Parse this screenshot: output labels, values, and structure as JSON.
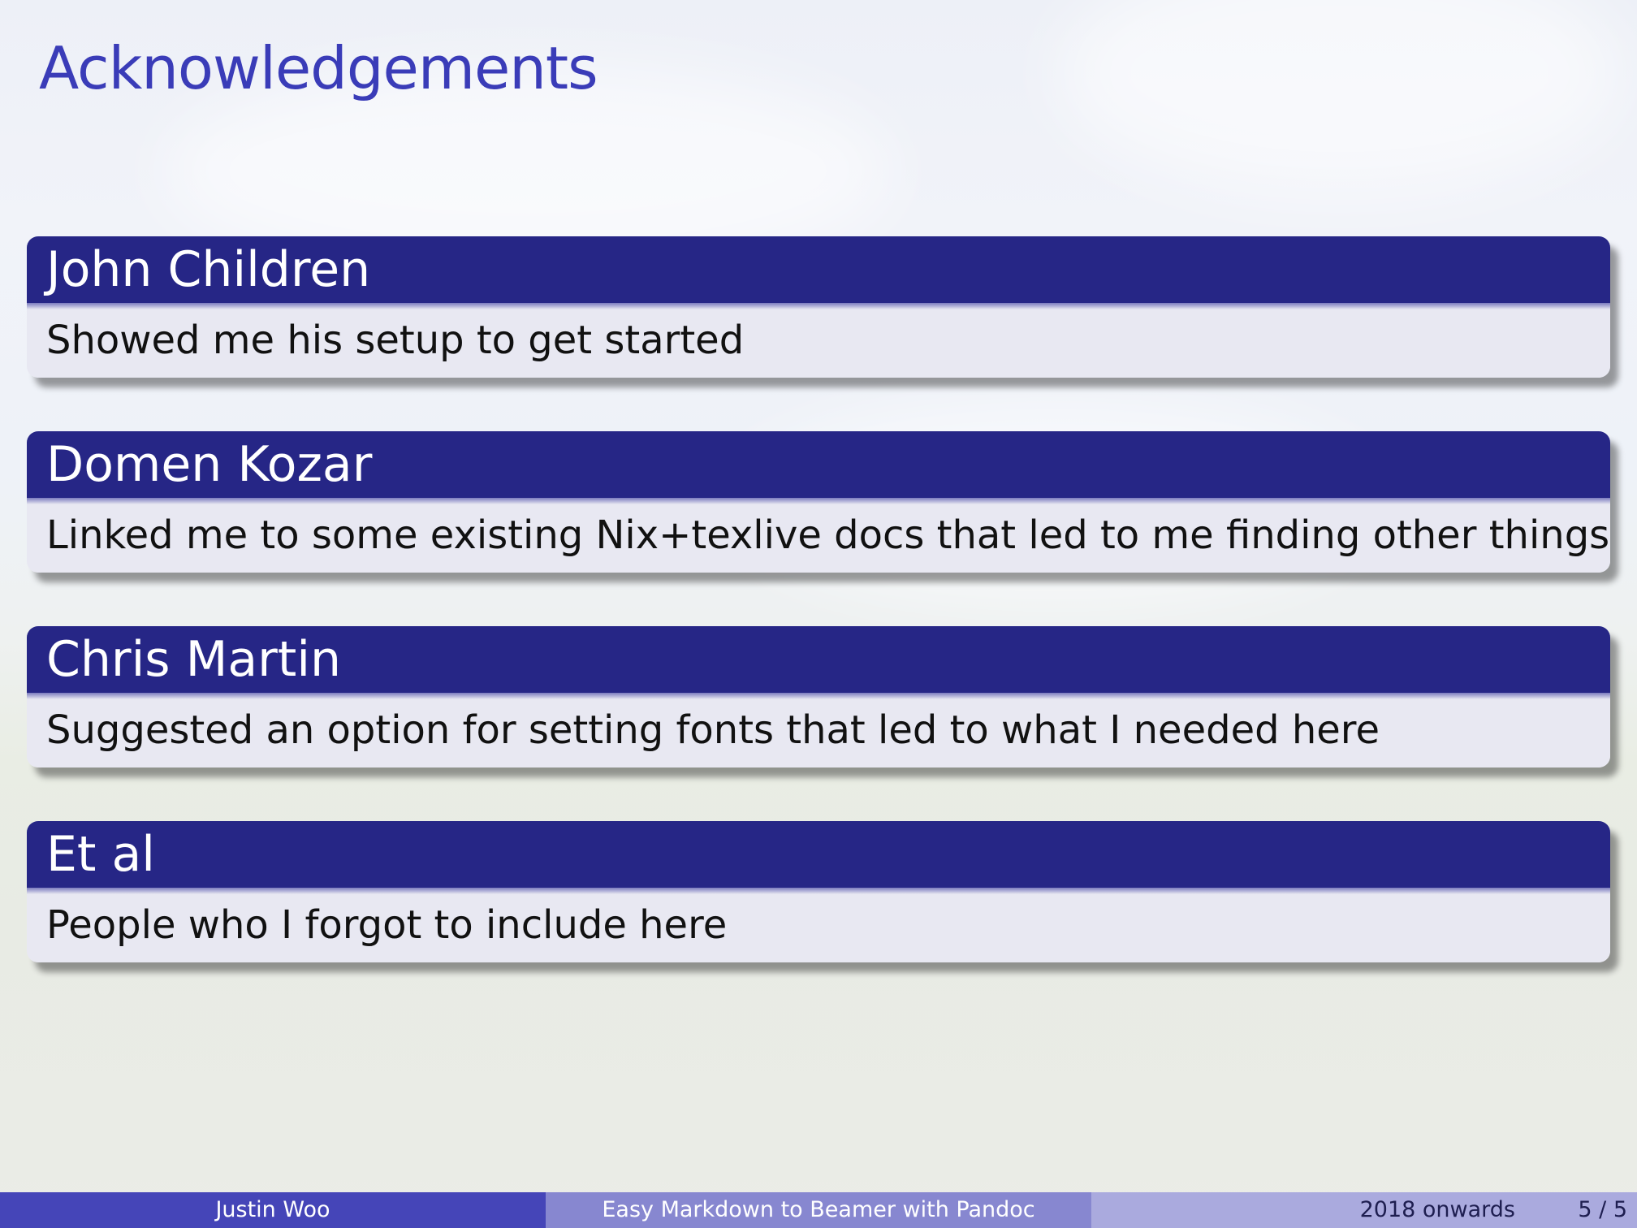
{
  "frame": {
    "title": "Acknowledgements"
  },
  "blocks": [
    {
      "title": "John Children",
      "body": "Showed me his setup to get started"
    },
    {
      "title": "Domen Kozar",
      "body": "Linked me to some existing Nix+texlive docs that led to me finding other things"
    },
    {
      "title": "Chris Martin",
      "body": "Suggested an option for setting fonts that led to what I needed here"
    },
    {
      "title": "Et al",
      "body": "People who I forgot to include here"
    }
  ],
  "footer": {
    "author": "Justin Woo",
    "title": "Easy Markdown to Beamer with Pandoc",
    "date": "2018 onwards",
    "page": "5 / 5"
  },
  "colors": {
    "block_title_bg": "#262686",
    "block_body_bg": "#e8e8f2",
    "frame_title": "#3a3cb8",
    "footer_author_bg": "#4545b8",
    "footer_title_bg": "#8787d0",
    "footer_date_bg": "#aaaade"
  }
}
